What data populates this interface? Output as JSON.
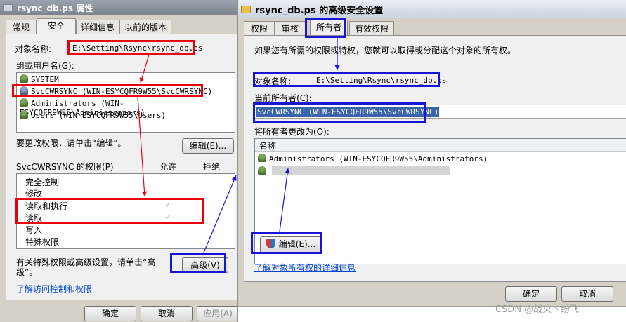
{
  "prop_window": {
    "title": "rsync_db.ps 属性",
    "tabs": [
      "常规",
      "安全",
      "详细信息",
      "以前的版本"
    ],
    "object_name_label": "对象名称:",
    "object_name_value": "E:\\Setting\\Rsync\\rsync_db.ps",
    "group_label": "组或用户名(G):",
    "users": [
      "SYSTEM",
      "SvcCWRSYNC (WIN-ESYCQFR9W55\\SvcCWRSYNC)",
      "Administrators (WIN-ESYCQFR9W55\\Administrators)",
      "Users (WIN-ESYCQFR9W55\\Users)"
    ],
    "change_perm_text": "要更改权限，请单击“编辑”。",
    "edit_button": "编辑(E)...",
    "perm_header": "SvcCWRSYNC 的权限(P)",
    "allow_header": "允许",
    "deny_header": "拒绝",
    "permissions": [
      "完全控制",
      "修改",
      "读取和执行",
      "",
      "读取",
      "写入",
      "特殊权限"
    ],
    "special_text_1": "有关特殊权限或高级设置，请单击“高",
    "special_text_2": "级”。",
    "advanced_button": "高级(V)",
    "learn_link": "了解访问控制和权限",
    "ok_button": "确定",
    "cancel_button": "取消",
    "apply_button": "应用(A)"
  },
  "adv_window": {
    "title": "rsync_db.ps 的高级安全设置",
    "tabs": [
      "权限",
      "审核",
      "所有者",
      "有效权限"
    ],
    "intro": "如果您有所需的权限或特权，您就可以取得或分配这个对象的所有权。",
    "object_name_label": "对象名称:",
    "object_name_value": "E:\\Setting\\Rsync\\rsync_db.ps",
    "current_owner_label": "当前所有者(C):",
    "current_owner_value": "SvcCWRSYNC (WIN-ESYCQFR9W55\\SvcCWRSYNC)",
    "change_owner_label": "将所有者更改为(O):",
    "name_header": "名称",
    "owners": [
      "Administrators (WIN-ESYCQFR9W55\\Administrators)"
    ],
    "edit_button": "编辑(E)...",
    "owner_link": "了解对象所有权的详细信息",
    "ok_button": "确定",
    "cancel_button": "取消"
  },
  "watermark": "CSDN @战火丶纷飞",
  "colors": {
    "annotation_red": "#e8000b",
    "annotation_blue": "#1a15d6",
    "link": "#0046d5"
  }
}
